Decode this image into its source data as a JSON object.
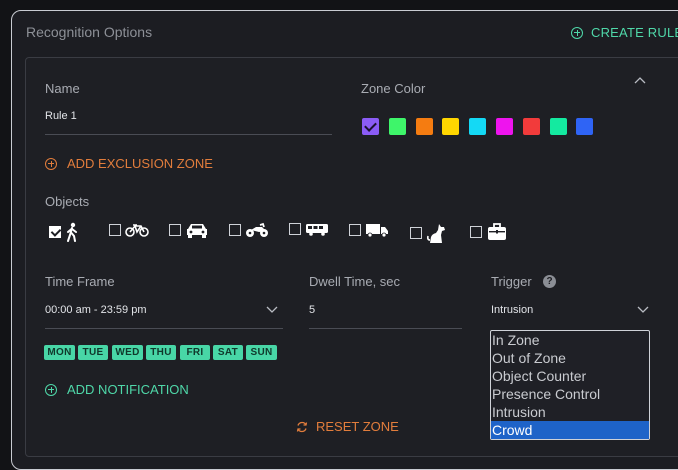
{
  "panel": {
    "title": "Recognition Options",
    "create_rule_label": "CREATE RULE"
  },
  "rule": {
    "name_label": "Name",
    "name_value": "Rule 1",
    "zone_color_label": "Zone Color",
    "zone_colors": [
      "#8b5cf6",
      "#3ef56a",
      "#f57c11",
      "#ffd600",
      "#14d9f5",
      "#ee14ee",
      "#f23b3b",
      "#14eaa0",
      "#2f64f5"
    ],
    "selected_color_index": 0,
    "add_exclusion_label": "ADD EXCLUSION ZONE",
    "objects_label": "Objects",
    "objects": [
      {
        "name": "person-icon",
        "checked": true
      },
      {
        "name": "bicycle-icon",
        "checked": false
      },
      {
        "name": "car-icon",
        "checked": false
      },
      {
        "name": "motorcycle-icon",
        "checked": false
      },
      {
        "name": "bus-icon",
        "checked": false
      },
      {
        "name": "truck-icon",
        "checked": false
      },
      {
        "name": "dog-icon",
        "checked": false
      },
      {
        "name": "bag-icon",
        "checked": false
      }
    ],
    "time_frame_label": "Time Frame",
    "time_frame_value": "00:00 am - 23:59 pm",
    "dwell_label": "Dwell Time, sec",
    "dwell_value": "5",
    "trigger_label": "Trigger",
    "trigger_value": "Intrusion",
    "days": [
      "MON",
      "TUE",
      "WED",
      "THU",
      "FRI",
      "SAT",
      "SUN"
    ],
    "add_notification_label": "ADD NOTIFICATION",
    "reset_zone_label": "RESET ZONE"
  },
  "trigger_options": [
    "In Zone",
    "Out of Zone",
    "Object Counter",
    "Presence Control",
    "Intrusion",
    "Crowd"
  ],
  "trigger_highlighted": "Crowd"
}
